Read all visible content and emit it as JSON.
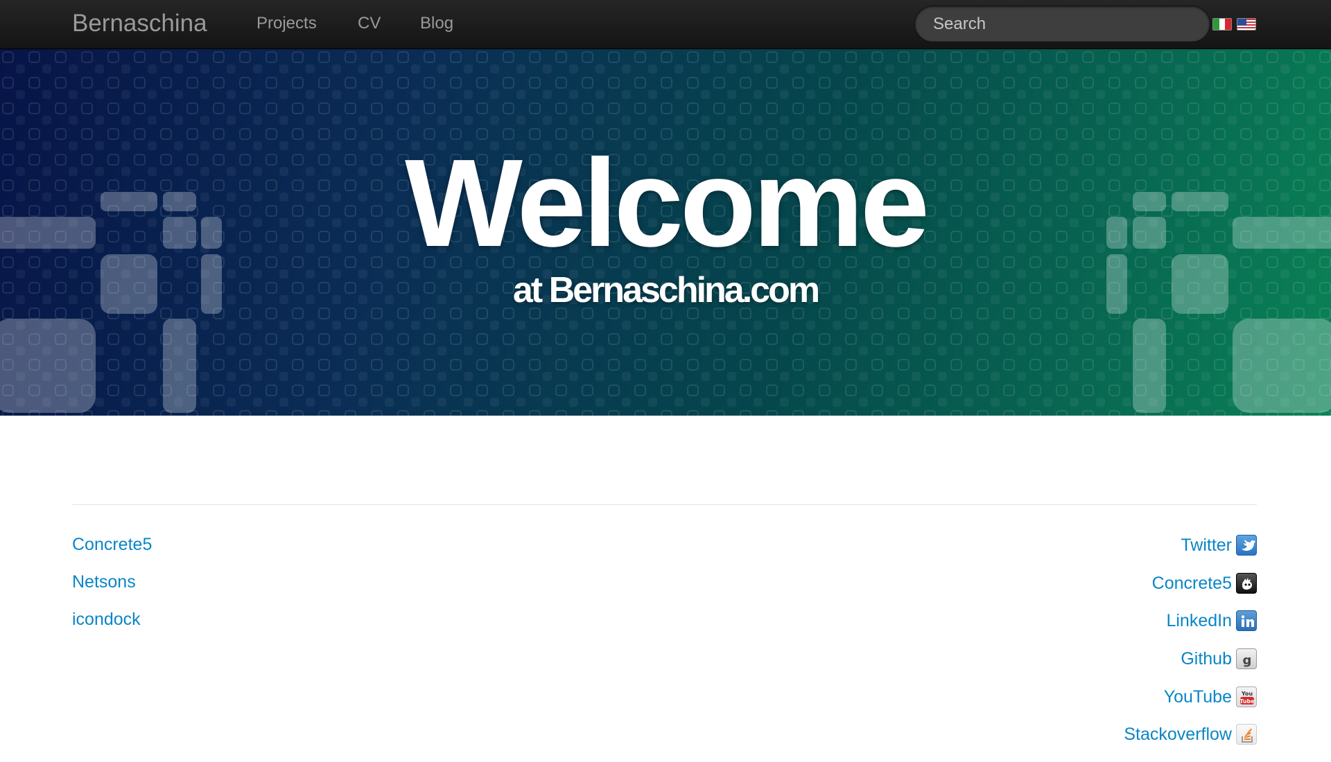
{
  "nav": {
    "brand": "Bernaschina",
    "links": [
      {
        "label": "Projects"
      },
      {
        "label": "CV"
      },
      {
        "label": "Blog"
      }
    ],
    "search_placeholder": "Search",
    "flags": [
      {
        "icon": "italy-flag-icon"
      },
      {
        "icon": "us-flag-icon"
      }
    ]
  },
  "hero": {
    "title": "Welcome",
    "subtitle": "at Bernaschina.com"
  },
  "footer": {
    "left_links": [
      {
        "label": "Concrete5"
      },
      {
        "label": "Netsons"
      },
      {
        "label": "icondock"
      }
    ],
    "right_links": [
      {
        "label": "Twitter",
        "icon": "twitter-icon"
      },
      {
        "label": "Concrete5",
        "icon": "concrete5-icon"
      },
      {
        "label": "LinkedIn",
        "icon": "linkedin-icon"
      },
      {
        "label": "Github",
        "icon": "github-icon"
      },
      {
        "label": "YouTube",
        "icon": "youtube-icon"
      },
      {
        "label": "Stackoverflow",
        "icon": "stackoverflow-icon"
      }
    ]
  },
  "colors": {
    "link": "#0a85c7",
    "navbar": "#1b1b1b",
    "hero_start": "#071447",
    "hero_end": "#0a8256"
  }
}
